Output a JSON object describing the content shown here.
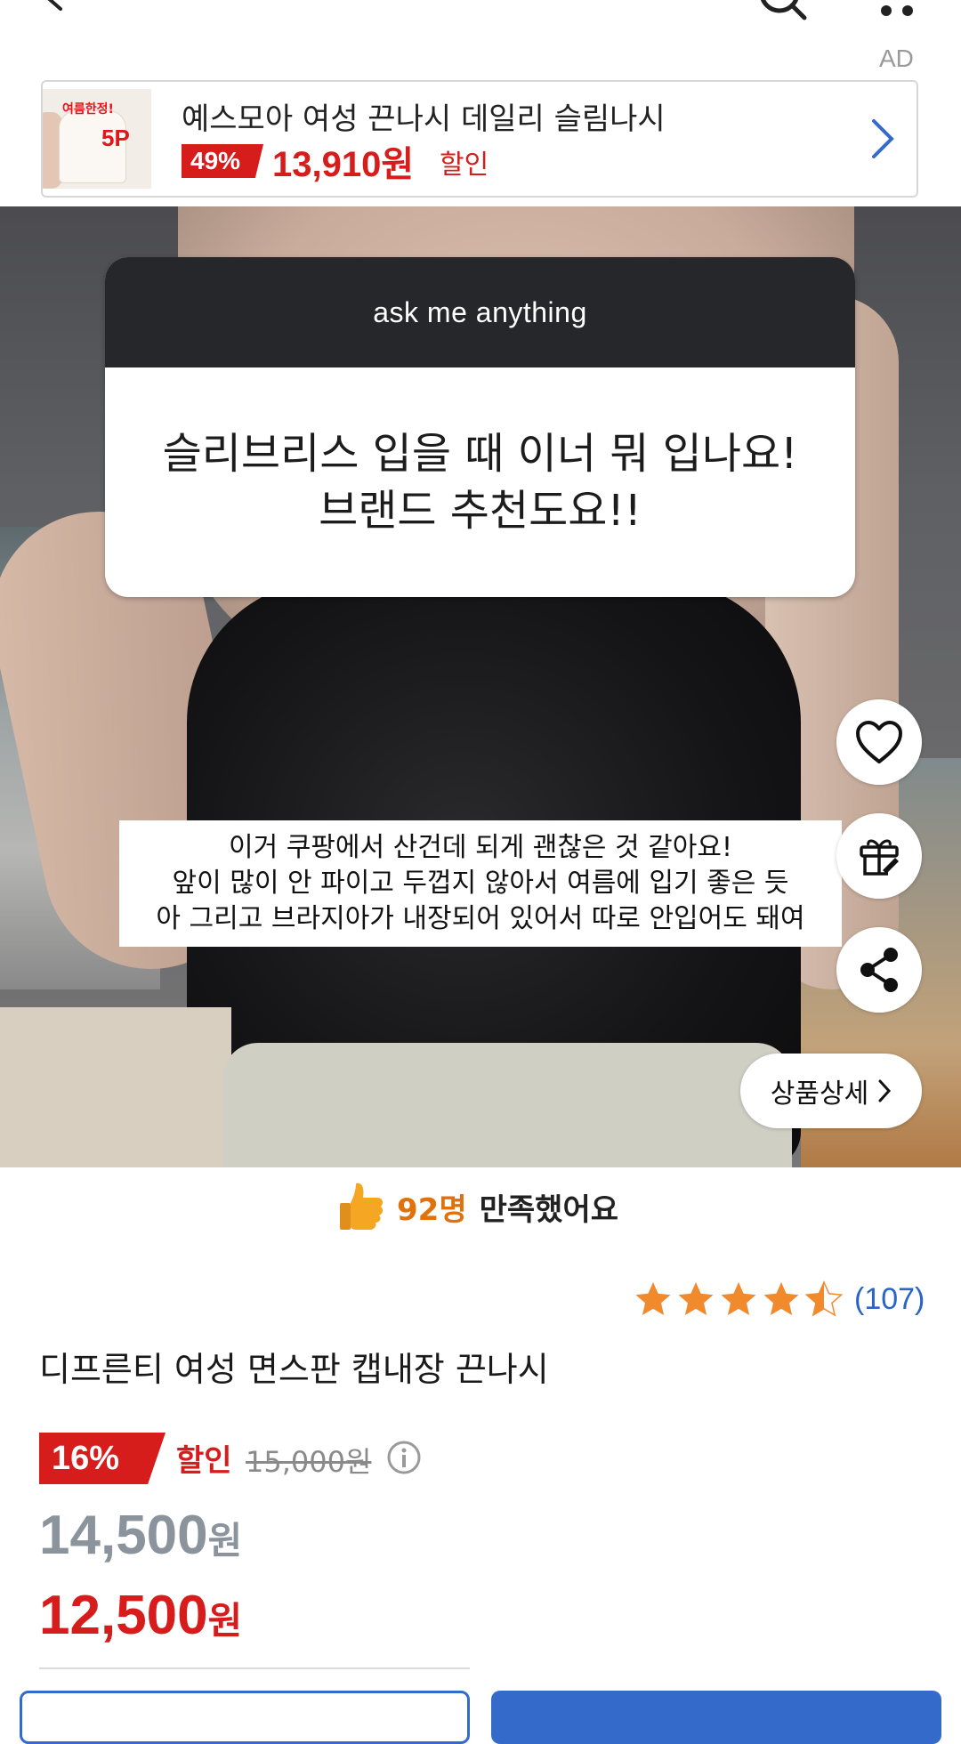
{
  "ad": {
    "tag": "AD",
    "thumb_badge": "여름한정!",
    "thumb_count": "5P",
    "title": "예스모아 여성 끈나시 데일리 슬림나시",
    "discount": "49%",
    "price": "13,910원",
    "sale_label": "할인"
  },
  "story": {
    "question_header": "ask me anything",
    "question_line1": "슬리브리스 입을 때 이너 뭐 입나요!",
    "question_line2": "브랜드 추천도요!!",
    "answer_line1": "이거 쿠팡에서 산건데 되게 괜찮은 것 같아요!",
    "answer_line2": "앞이 많이 안 파이고 두껍지 않아서 여름에 입기 좋은 듯",
    "answer_line3": "아 그리고 브라지아가 내장되어 있어서 따로 안입어도 돼여"
  },
  "actions": {
    "detail_label": "상품상세",
    "like_icon": "heart-icon",
    "gift_icon": "gift-icon",
    "share_icon": "share-icon"
  },
  "satisfied": {
    "count": "92명",
    "label": "만족했어요"
  },
  "product": {
    "rating": 4.5,
    "review_count": "(107)",
    "title": "디프른티 여성 면스판 캡내장 끈나시",
    "discount": "16%",
    "discount_label": "할인",
    "original_price": "15,000원",
    "price_gray_number": "14,500",
    "price_gray_unit": "원",
    "price_red_number": "12,500",
    "price_red_unit": "원"
  },
  "colors": {
    "accent_red": "#d71c1c",
    "accent_blue": "#346aca",
    "star_orange": "#f08a2c",
    "satisfied_orange": "#e0720b"
  }
}
